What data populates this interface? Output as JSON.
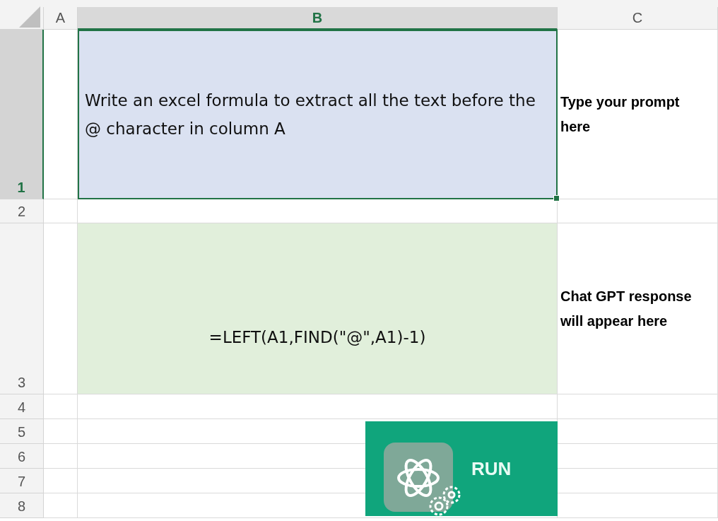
{
  "columns": [
    {
      "label": "A",
      "selected": false
    },
    {
      "label": "B",
      "selected": true
    },
    {
      "label": "C",
      "selected": false
    }
  ],
  "rows": [
    {
      "label": "1",
      "selected": true,
      "b": {
        "text": "Write an excel formula to extract all the text before the @ character in column A",
        "color": "#dae1f1",
        "selected": true
      },
      "c": {
        "text": "Type your prompt here"
      }
    },
    {
      "label": "2",
      "selected": false
    },
    {
      "label": "3",
      "selected": false,
      "b": {
        "text": "=LEFT(A1,FIND(\"@\",A1)-1)",
        "color": "#e1efdb",
        "selected": false
      },
      "c": {
        "text": "Chat GPT response will appear here"
      }
    },
    {
      "label": "4",
      "selected": false
    },
    {
      "label": "5",
      "selected": false
    },
    {
      "label": "6",
      "selected": false
    },
    {
      "label": "7",
      "selected": false
    },
    {
      "label": "8",
      "selected": false
    }
  ],
  "run_button": {
    "label": "RUN"
  }
}
